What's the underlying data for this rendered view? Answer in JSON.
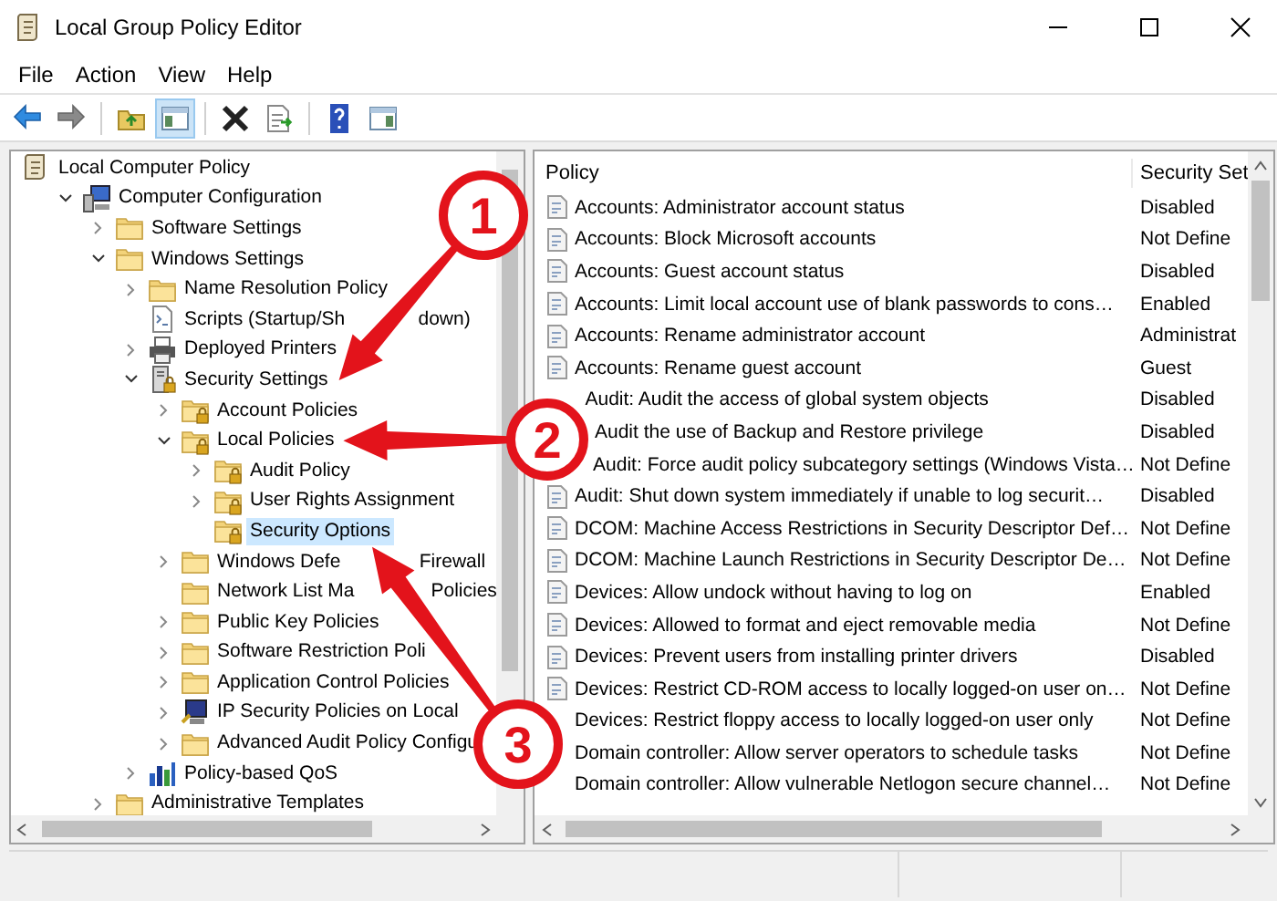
{
  "window": {
    "title": "Local Group Policy Editor"
  },
  "menu": [
    "File",
    "Action",
    "View",
    "Help"
  ],
  "toolbar": [
    {
      "kind": "back",
      "pressed": false
    },
    {
      "kind": "forward",
      "pressed": false
    },
    {
      "kind": "separator"
    },
    {
      "kind": "up",
      "pressed": false
    },
    {
      "kind": "tree",
      "pressed": true
    },
    {
      "kind": "separator"
    },
    {
      "kind": "delete",
      "pressed": false
    },
    {
      "kind": "export",
      "pressed": false
    },
    {
      "kind": "separator"
    },
    {
      "kind": "help",
      "pressed": false
    },
    {
      "kind": "pane",
      "pressed": false
    }
  ],
  "tree": [
    {
      "label": "Local Computer Policy",
      "kind": "scroll",
      "selected": false,
      "children": [
        {
          "label": "Computer Configuration",
          "kind": "computer",
          "expanded": true,
          "selected": false,
          "children": [
            {
              "label": "Software Settings",
              "kind": "folder",
              "expanded": false,
              "selected": false
            },
            {
              "label": "Windows Settings",
              "kind": "folder",
              "expanded": true,
              "selected": false,
              "children": [
                {
                  "label": "Name Resolution Policy",
                  "kind": "folder",
                  "expanded": false,
                  "selected": false
                },
                {
                  "label": "Scripts (Startup/Sh",
                  "label_after": "down)",
                  "kind": "script",
                  "selected": false
                },
                {
                  "label": "Deployed Printers",
                  "kind": "printer",
                  "expanded": false,
                  "selected": false
                },
                {
                  "label": "Security Settings",
                  "kind": "security",
                  "expanded": true,
                  "selected": false,
                  "children": [
                    {
                      "label": "Account Policies",
                      "kind": "locked",
                      "expanded": false,
                      "selected": false
                    },
                    {
                      "label": "Local Policies",
                      "kind": "locked",
                      "expanded": true,
                      "selected": false,
                      "children": [
                        {
                          "label": "Audit Policy",
                          "kind": "locked",
                          "expanded": false,
                          "selected": false
                        },
                        {
                          "label": "User Rights Assignment",
                          "kind": "locked",
                          "expanded": false,
                          "selected": false
                        },
                        {
                          "label": "Security Options",
                          "kind": "locked",
                          "selected": true
                        }
                      ]
                    },
                    {
                      "label": "Windows Defe",
                      "label_after": "Firewall",
                      "kind": "folder",
                      "expanded": false,
                      "selected": false
                    },
                    {
                      "label": "Network List Ma",
                      "label_after": "Policies",
                      "kind": "folder",
                      "selected": false
                    },
                    {
                      "label": "Public Key Policies",
                      "kind": "folder",
                      "expanded": false,
                      "selected": false
                    },
                    {
                      "label": "Software Restriction Poli",
                      "kind": "folder",
                      "expanded": false,
                      "selected": false
                    },
                    {
                      "label": "Application Control Policies",
                      "kind": "folder",
                      "expanded": false,
                      "selected": false
                    },
                    {
                      "label": "IP Security Policies on Local",
                      "kind": "ipsec",
                      "expanded": false,
                      "selected": false
                    },
                    {
                      "label": "Advanced Audit Policy Configu",
                      "kind": "folder",
                      "expanded": false,
                      "selected": false
                    }
                  ]
                },
                {
                  "label": "Policy-based QoS",
                  "kind": "qos",
                  "expanded": false,
                  "selected": false
                }
              ]
            },
            {
              "label": "Administrative Templates",
              "kind": "folder",
              "expanded": false,
              "selected": false
            }
          ]
        }
      ]
    }
  ],
  "list": {
    "columns": [
      "Policy",
      "Security Set"
    ],
    "rows": [
      {
        "policy": "Accounts: Administrator account status",
        "setting": "Disabled"
      },
      {
        "policy": "Accounts: Block Microsoft accounts",
        "setting": "Not Define"
      },
      {
        "policy": "Accounts: Guest account status",
        "setting": "Disabled"
      },
      {
        "policy": "Accounts: Limit local account use of blank passwords to cons…",
        "setting": "Enabled"
      },
      {
        "policy": "Accounts: Rename administrator account",
        "setting": "Administrat"
      },
      {
        "policy": "Accounts: Rename guest account",
        "setting": "Guest"
      },
      {
        "policy": "Audit: Audit the access of global system objects",
        "setting": "Disabled"
      },
      {
        "policy": "Audit the use of Backup and Restore privilege",
        "setting": "Disabled"
      },
      {
        "policy": "Audit: Force audit policy subcategory settings (Windows Vista…",
        "setting": "Not Define"
      },
      {
        "policy": "Audit: Shut down system immediately if unable to log securit…",
        "setting": "Disabled"
      },
      {
        "policy": "DCOM: Machine Access Restrictions in Security Descriptor Def…",
        "setting": "Not Define"
      },
      {
        "policy": "DCOM: Machine Launch Restrictions in Security Descriptor De…",
        "setting": "Not Define"
      },
      {
        "policy": "Devices: Allow undock without having to log on",
        "setting": "Enabled"
      },
      {
        "policy": "Devices: Allowed to format and eject removable media",
        "setting": "Not Define"
      },
      {
        "policy": "Devices: Prevent users from installing printer drivers",
        "setting": "Disabled"
      },
      {
        "policy": "Devices: Restrict CD-ROM access to locally logged-on user on…",
        "setting": "Not Define"
      },
      {
        "policy": "Devices: Restrict floppy access to locally logged-on user only",
        "setting": "Not Define"
      },
      {
        "policy": "Domain controller: Allow server operators to schedule tasks",
        "setting": "Not Define"
      },
      {
        "policy": "Domain controller: Allow vulnerable Netlogon secure channel…",
        "setting": "Not Define"
      }
    ]
  },
  "annotations": [
    {
      "label": "1"
    },
    {
      "label": "2"
    },
    {
      "label": "3"
    }
  ]
}
